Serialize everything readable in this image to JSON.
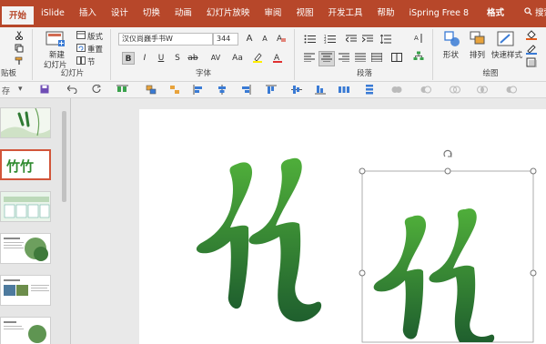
{
  "tabs": [
    {
      "label": "开始",
      "active": true
    },
    {
      "label": "iSlide"
    },
    {
      "label": "插入"
    },
    {
      "label": "设计"
    },
    {
      "label": "切换"
    },
    {
      "label": "动画"
    },
    {
      "label": "幻灯片放映"
    },
    {
      "label": "审阅"
    },
    {
      "label": "视图"
    },
    {
      "label": "开发工具"
    },
    {
      "label": "帮助"
    },
    {
      "label": "iSpring Free 8"
    },
    {
      "label": "格式"
    },
    {
      "label": "搜索"
    }
  ],
  "ribbon": {
    "clipboard_label": "贴板",
    "slides": {
      "new_slide": "新建",
      "new_slide2": "幻灯片",
      "layout": "版式",
      "reset": "重置",
      "section": "节",
      "label": "幻灯片"
    },
    "font": {
      "font_name": "汉仪尚巍手书W",
      "font_size": "344",
      "bold": "B",
      "italic": "I",
      "underline": "U",
      "strike": "S",
      "shadow": "ab",
      "spacing": "AV",
      "case": "Aa",
      "grow": "A",
      "shrink": "A",
      "label": "字体"
    },
    "paragraph_label": "段落",
    "drawing": {
      "shapes": "形状",
      "arrange": "排列",
      "quick_styles": "快速样式",
      "label": "绘图"
    }
  },
  "qat": {
    "left_label": "存"
  },
  "slide_art": {
    "char1": "竹",
    "char2": "竹"
  },
  "thumbs_text": {
    "t2": "竹竹"
  },
  "colors": {
    "brand": "#b7472a",
    "green_dark": "#1f5f2e",
    "green_light": "#4fae3a"
  }
}
